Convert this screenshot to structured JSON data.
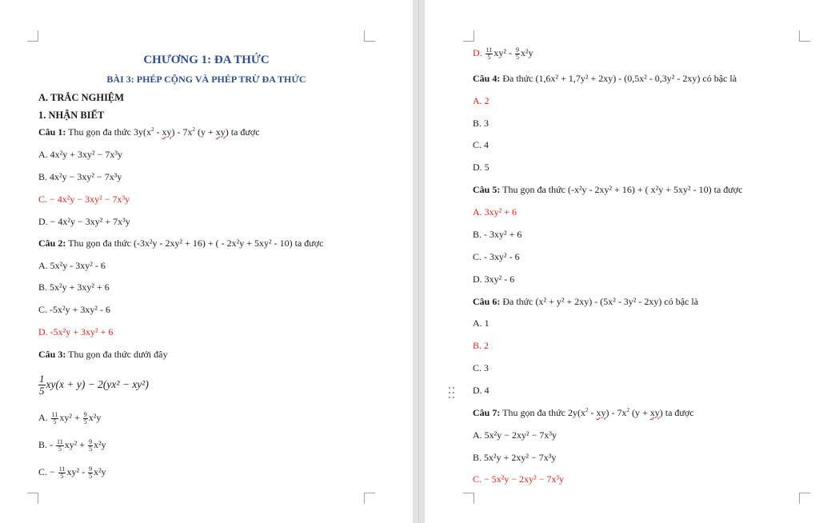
{
  "left_page": {
    "chapter_title": "CHƯƠNG 1: ĐA THỨC",
    "lesson_title": "BÀI 3: PHÉP CỘNG VÀ PHÉP TRỪ ĐA THỨC",
    "section_a": "A. TRẮC NGHIỆM",
    "section_1": "1. NHẬN BIẾT",
    "q1": {
      "label": "Câu 1:",
      "text_pre": "Thu gọn đa thức 3y(x",
      "text_mid1": " - ",
      "text_xy": "xy",
      "text_mid2": ") - 7x",
      "text_mid3": " (y + ",
      "text_post": ") ta được",
      "options": [
        "A. 4x²y + 3xy² − 7x³y",
        "B. 4x²y − 3xy² − 7x³y",
        "C. − 4x²y − 3xy² − 7x³y",
        "D. − 4x²y − 3xy² + 7x³y"
      ]
    },
    "q2": {
      "label": "Câu 2:",
      "text": "Thu gọn đa thức (-3x²y - 2xy² + 16) + ( - 2x²y + 5xy² - 10) ta được",
      "options": [
        "A. 5x²y - 3xy² - 6",
        "B. 5x²y + 3xy² + 6",
        "C. -5x²y + 3xy² - 6",
        "D. -5x²y + 3xy² + 6"
      ]
    },
    "q3": {
      "label": "Câu 3:",
      "text": "Thu gọn đa thức dưới đây",
      "expr_num": "1",
      "expr_den": "5",
      "expr_rest": "xy(x + y) − 2(yx² − xy²)",
      "opt_a": {
        "prefix": "A. ",
        "f1": [
          "11",
          "5"
        ],
        "mid": "xy² + ",
        "f2": [
          "9",
          "5"
        ],
        "tail": "x²y"
      },
      "opt_b": {
        "prefix": "B. - ",
        "f1": [
          "11",
          "5"
        ],
        "mid": "xy² + ",
        "f2": [
          "9",
          "5"
        ],
        "tail": "x²y"
      },
      "opt_c": {
        "prefix": "C. − ",
        "f1": [
          "11",
          "5"
        ],
        "mid": "xy² - ",
        "f2": [
          "9",
          "5"
        ],
        "tail": "x²y"
      }
    }
  },
  "right_page": {
    "q3_opt_d": {
      "prefix": "D. ",
      "f1": [
        "11",
        "5"
      ],
      "mid": "xy² - ",
      "f2": [
        "9",
        "5"
      ],
      "tail": "x²y"
    },
    "q4": {
      "label": "Câu 4:",
      "text": "Đa thức (1,6x² + 1,7y² + 2xy) - (0,5x² - 0,3y² - 2xy) có bậc là",
      "options": [
        "A. 2",
        "B. 3",
        "C. 4",
        "D. 5"
      ]
    },
    "q5": {
      "label": "Câu 5:",
      "text": "Thu gọn đa thức (-x²y - 2xy² + 16) + ( x²y + 5xy² - 10) ta được",
      "options": [
        "A. 3xy² + 6",
        "B. - 3xy² + 6",
        "C. - 3xy² - 6",
        "D. 3xy² - 6"
      ]
    },
    "q6": {
      "label": "Câu 6:",
      "text": "Đa thức (x² + y² + 2xy) - (5x² - 3y² - 2xy) có bậc là",
      "options": [
        "A. 1",
        "B. 2",
        "C. 3",
        "D. 4"
      ]
    },
    "q7": {
      "label": "Câu 7:",
      "text_pre": "Thu gọn đa thức 2y(x",
      "text_mid1": " - ",
      "text_xy": "xy",
      "text_mid2": ") - 7x",
      "text_mid3": " (y + ",
      "text_post": ") ta được",
      "options": [
        "A. 5x²y − 2xy² − 7x³y",
        "B. 5x²y + 2xy² − 7x³y",
        "C. − 5x²y − 2xy² − 7x³y"
      ]
    }
  },
  "colors": {
    "heading": "#2e4f8a",
    "correct_answer": "#e2231a",
    "text": "#1a1a1a"
  }
}
